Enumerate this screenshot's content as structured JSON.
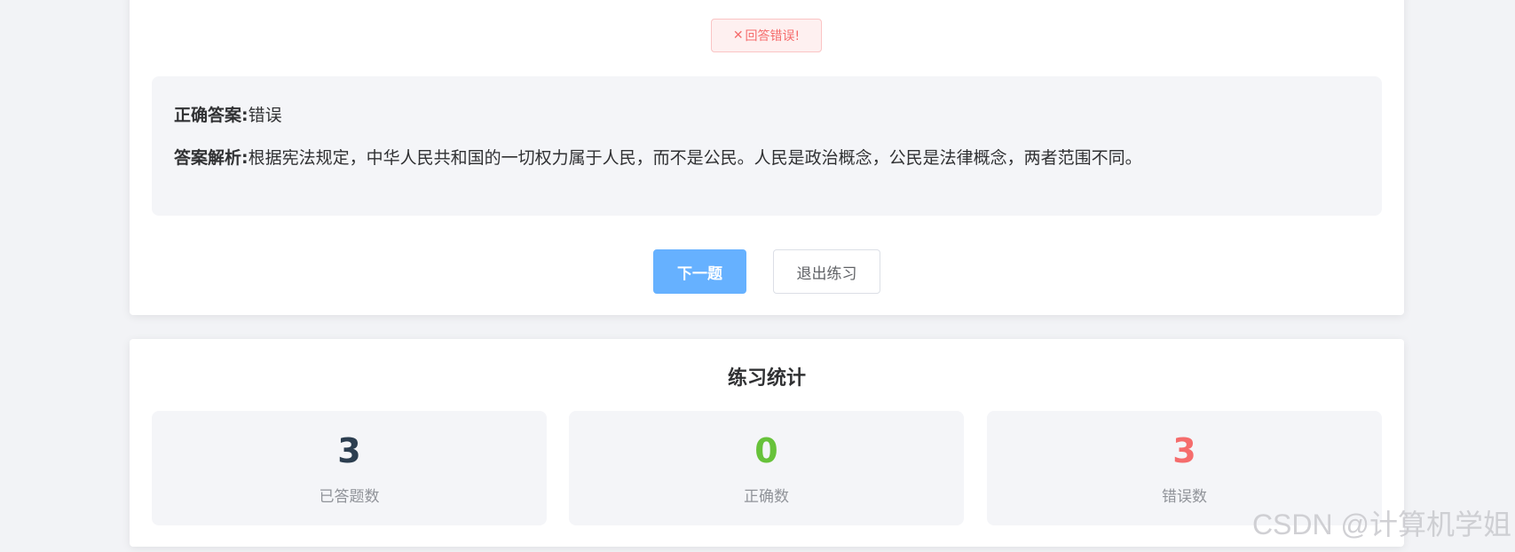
{
  "result": {
    "icon": "close-icon",
    "icon_glyph": "✕",
    "message": "回答错误!",
    "color": "#f56c6c"
  },
  "answer": {
    "correct_label": "正确答案:",
    "correct_value": "错误",
    "analysis_label": "答案解析:",
    "analysis_text": "根据宪法规定，中华人民共和国的一切权力属于人民，而不是公民。人民是政治概念，公民是法律概念，两者范围不同。"
  },
  "actions": {
    "next_label": "下一题",
    "exit_label": "退出练习",
    "primary_color": "#66b1ff"
  },
  "stats": {
    "title": "练习统计",
    "items": [
      {
        "value": "3",
        "label": "已答题数",
        "color": "#2c3e50"
      },
      {
        "value": "0",
        "label": "正确数",
        "color": "#67c23a"
      },
      {
        "value": "3",
        "label": "错误数",
        "color": "#f56c6c"
      }
    ]
  },
  "watermark": "CSDN @计算机学姐"
}
